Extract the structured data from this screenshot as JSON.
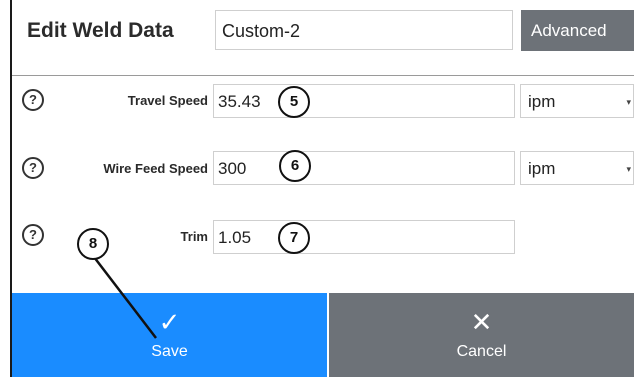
{
  "header": {
    "title": "Edit Weld Data",
    "preset_value": "Custom-2",
    "advanced_label": "Advanced"
  },
  "fields": [
    {
      "help": "?",
      "label": "Travel Speed",
      "value": "35.43",
      "unit": "ipm",
      "callout": "5"
    },
    {
      "help": "?",
      "label": "Wire Feed Speed",
      "value": "300",
      "unit": "ipm",
      "callout": "6"
    },
    {
      "help": "?",
      "label": "Trim",
      "value": "1.05",
      "callout": "7"
    }
  ],
  "callout_save": "8",
  "footer": {
    "save_label": "Save",
    "save_icon": "checkmark-icon",
    "save_glyph": "✓",
    "cancel_label": "Cancel",
    "cancel_icon": "close-icon",
    "cancel_glyph": "✕"
  },
  "colors": {
    "save": "#1a8cff",
    "cancel": "#6d7278",
    "advanced": "#6d7278"
  }
}
